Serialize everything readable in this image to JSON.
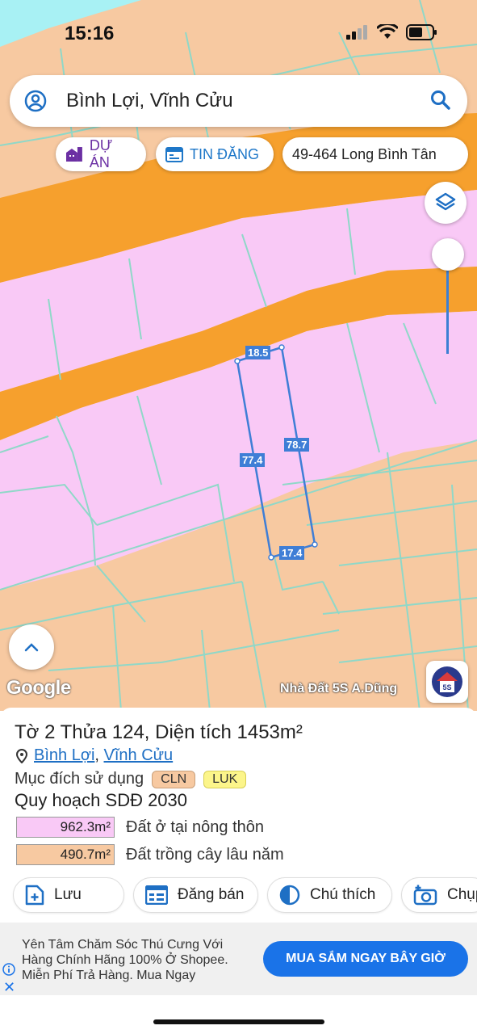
{
  "status_bar": {
    "time": "15:16"
  },
  "search": {
    "query": "Bình Lợi, Vĩnh Cửu"
  },
  "chips": {
    "du_an": "DỰ ÁN",
    "tin_dang": "TIN ĐĂNG",
    "address": "49-464 Long Bình Tân"
  },
  "map": {
    "dimensions": {
      "top": "18.5",
      "left": "77.4",
      "right": "78.7",
      "bottom": "17.4"
    },
    "google_logo": "Google",
    "credit": "Nhà Đất 5S A.Dũng",
    "brand_badge": "5S",
    "colors": {
      "cln": "#f7c9a1",
      "road": "#f6a02d",
      "residential": "#f9c9f6",
      "outline": "#3f7ed6"
    }
  },
  "parcel": {
    "title_prefix": "Tờ 2 Thửa ",
    "title_number": "124",
    "title_mid": ", Diện tích ",
    "title_area": "1453m²",
    "ward": "Bình Lợi",
    "separator": ", ",
    "district": "Vĩnh Cửu",
    "purpose_label": "Mục đích sử dụng",
    "purpose_tags": [
      "CLN",
      "LUK"
    ],
    "plan_title": "Quy hoạch SDĐ 2030",
    "plan_rows": [
      {
        "area": "962.3m²",
        "label": "Đất ở tại nông thôn",
        "color": "#f9c9f6"
      },
      {
        "area": "490.7m²",
        "label": "Đất trồng cây lâu năm",
        "color": "#f7c9a1"
      }
    ]
  },
  "actions": {
    "save": "Lưu",
    "post": "Đăng bán",
    "legend": "Chú thích",
    "capture": "Chụp"
  },
  "ad": {
    "text": "Yên Tâm Chăm Sóc Thú Cưng Với Hàng Chính Hãng 100% Ở Shopee. Miễn Phí Trả Hàng. Mua Ngay",
    "button": "MUA SẮM NGAY BÂY GIỜ",
    "accent": "#1a73e8"
  }
}
